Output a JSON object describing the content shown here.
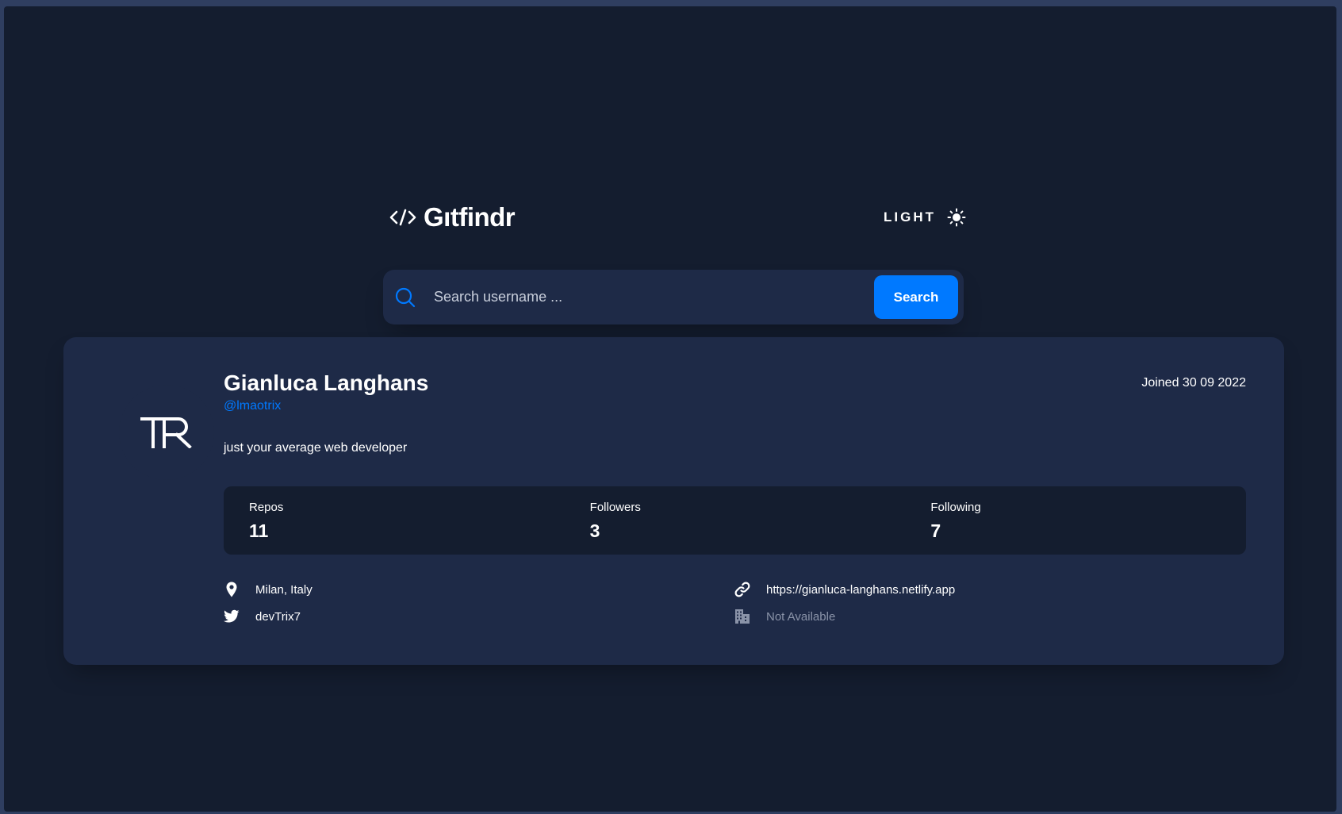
{
  "header": {
    "logo_text": "Gıtfindr",
    "theme_label": "LIGHT"
  },
  "search": {
    "placeholder": "Search username ...",
    "value": "",
    "button_label": "Search"
  },
  "profile": {
    "avatar_text": "TR",
    "name": "Gianluca Langhans",
    "login": "@lmaotrix",
    "joined": "Joined 30 09 2022",
    "bio": "just your average web developer",
    "stats": [
      {
        "label": "Repos",
        "value": "11"
      },
      {
        "label": "Followers",
        "value": "3"
      },
      {
        "label": "Following",
        "value": "7"
      }
    ],
    "location": "Milan, Italy",
    "blog": "https://gianluca-langhans.netlify.app",
    "twitter": "devTrix7",
    "company": "Not Available"
  },
  "colors": {
    "background": "#141d2f",
    "card": "#1e2a47",
    "accent": "#0079ff",
    "text": "#ffffff",
    "muted": "#8a93a8"
  },
  "icons": [
    "code-icon",
    "sun-icon",
    "search-icon",
    "location-icon",
    "link-icon",
    "twitter-icon",
    "company-icon"
  ]
}
